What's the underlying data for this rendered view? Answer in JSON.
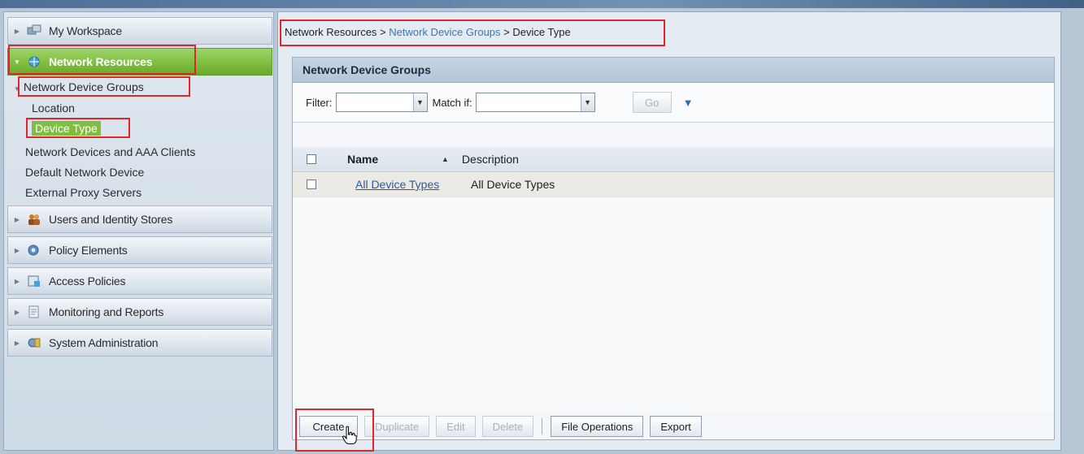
{
  "sidebar": {
    "workspace": {
      "label": "My Workspace",
      "icon": "workspace-icon"
    },
    "network_resources": {
      "label": "Network Resources",
      "icon": "network-icon"
    },
    "network_device_groups": "Network Device Groups",
    "location": "Location",
    "device_type": "Device Type",
    "network_devices": "Network Devices and AAA Clients",
    "default_device": "Default Network Device",
    "external_proxy": "External Proxy Servers",
    "users": {
      "label": "Users and Identity Stores",
      "icon": "users-icon"
    },
    "policy": {
      "label": "Policy Elements",
      "icon": "policy-icon"
    },
    "access": {
      "label": "Access Policies",
      "icon": "access-icon"
    },
    "monitoring": {
      "label": "Monitoring and Reports",
      "icon": "monitoring-icon"
    },
    "admin": {
      "label": "System Administration",
      "icon": "admin-icon"
    }
  },
  "breadcrumb": {
    "root": "Network Resources",
    "sep1": " > ",
    "middle": "Network Device Groups",
    "sep2": " > ",
    "current": "Device Type"
  },
  "panel": {
    "title": "Network Device Groups",
    "filter_label": "Filter:",
    "filter_value": "",
    "match_label": "Match if:",
    "match_value": "",
    "go_label": "Go"
  },
  "table": {
    "columns": [
      "Name",
      "Description"
    ],
    "rows": [
      {
        "name": "All Device Types",
        "description": "All Device Types"
      }
    ]
  },
  "actions": {
    "create": "Create",
    "duplicate": "Duplicate",
    "edit": "Edit",
    "delete": "Delete",
    "file_operations": "File Operations",
    "export": "Export"
  },
  "colors": {
    "active_green": "#7fbf3f",
    "link_blue": "#2d5a9c",
    "highlight_red": "#e0262b"
  }
}
